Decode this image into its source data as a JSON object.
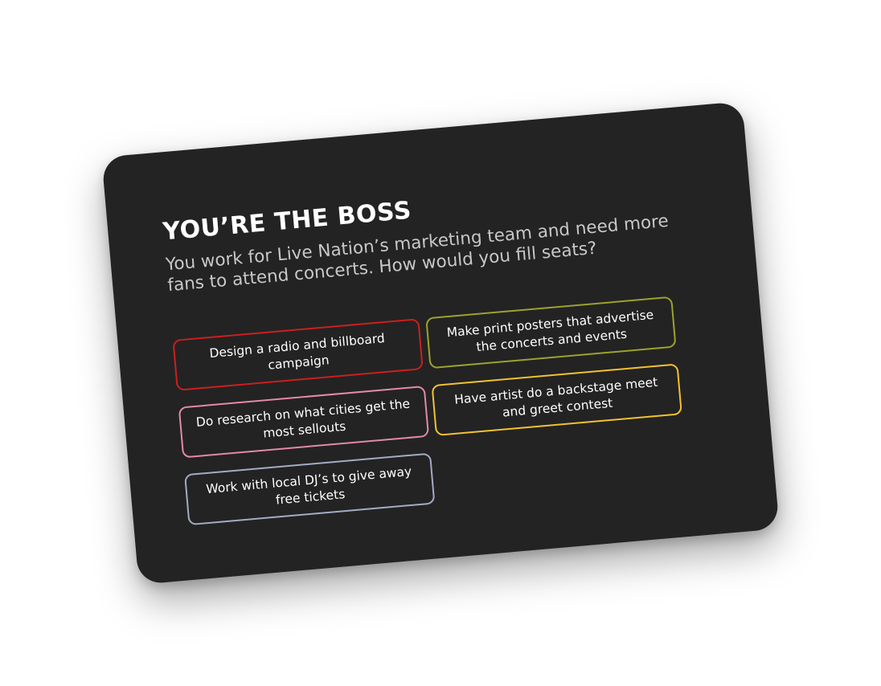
{
  "card": {
    "title": "YOU’RE THE BOSS",
    "prompt": "You work for Live Nation’s marketing team and need more fans to attend concerts. How would you fill seats?"
  },
  "options": [
    {
      "label": "Design a radio and billboard campaign",
      "border_color": "#cc1f1f"
    },
    {
      "label": "Make print posters that advertise the concerts and events",
      "border_color": "#9ea22c"
    },
    {
      "label": "Do research on what cities get the most sellouts",
      "border_color": "#e48aa6"
    },
    {
      "label": "Have artist do a backstage meet and greet contest",
      "border_color": "#f2c230"
    },
    {
      "label": "Work with local DJ’s to give away free tickets",
      "border_color": "#a2acc4"
    }
  ],
  "colors": {
    "card_background": "#232323",
    "title_text": "#ffffff",
    "prompt_text": "#c8c8c8"
  }
}
